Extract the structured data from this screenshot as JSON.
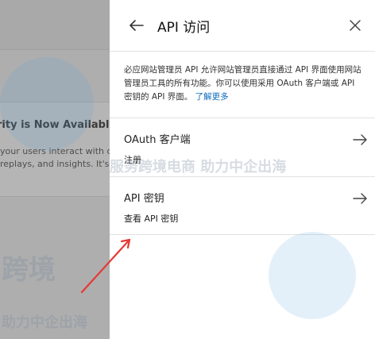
{
  "background": {
    "card_title": "rity is Now Available!",
    "card_text": "your users interact with on replays, and insights. It's"
  },
  "watermark": {
    "line1": "服务跨境电商 助力中企出海",
    "line2": "助力中企出海",
    "brand": "跨境"
  },
  "panel": {
    "title": "API 访问",
    "description": "必应网站管理员 API 允许网站管理员直接通过 API 界面使用网站管理员工具的所有功能。你可以使用采用 OAuth 客户端或 API 密钥的 API 界面。",
    "learn_more": "了解更多",
    "options": [
      {
        "title": "OAuth 客户端",
        "subtitle": "注册"
      },
      {
        "title": "API 密钥",
        "subtitle": "查看 API 密钥"
      }
    ]
  },
  "colors": {
    "accent": "#0f6cbd",
    "annotation": "#e53935"
  },
  "icons": {
    "back": "arrow-left-icon",
    "close": "close-icon",
    "option_arrow": "arrow-right-icon"
  }
}
